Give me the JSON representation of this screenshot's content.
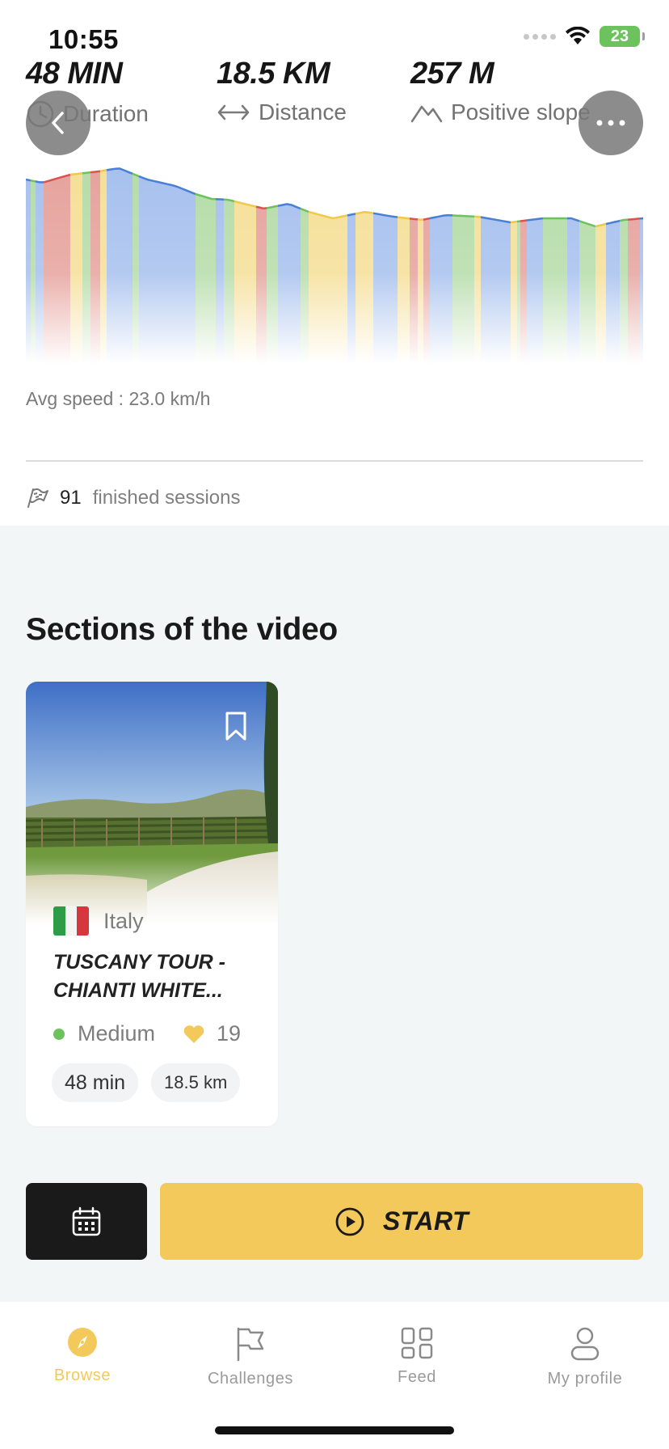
{
  "status_bar": {
    "time": "10:55",
    "battery": "23"
  },
  "stats": {
    "duration": {
      "value": "48 MIN",
      "label": "Duration"
    },
    "distance": {
      "value": "18.5 KM",
      "label": "Distance"
    },
    "slope": {
      "value": "257 M",
      "label": "Positive slope"
    }
  },
  "avg_speed": "Avg speed : 23.0 km/h",
  "sessions": {
    "count": "91",
    "label": "finished sessions"
  },
  "sections": {
    "title": "Sections of the video",
    "card": {
      "country": "Italy",
      "title": "TUSCANY TOUR - CHIANTI WHITE...",
      "level": "Medium",
      "likes": "19",
      "duration": "48 min",
      "distance": "18.5 km"
    }
  },
  "actions": {
    "start_label": "START"
  },
  "tabs": [
    {
      "label": "Browse",
      "icon": "compass-icon",
      "active": true
    },
    {
      "label": "Challenges",
      "icon": "flag-icon",
      "active": false
    },
    {
      "label": "Feed",
      "icon": "grid-icon",
      "active": false
    },
    {
      "label": "My profile",
      "icon": "person-icon",
      "active": false
    }
  ],
  "colors": {
    "accent": "#f3c95b",
    "green": "#6cc25c",
    "blue": "#4a7fd6",
    "red": "#d9534f",
    "yellow": "#f3d35c"
  }
}
